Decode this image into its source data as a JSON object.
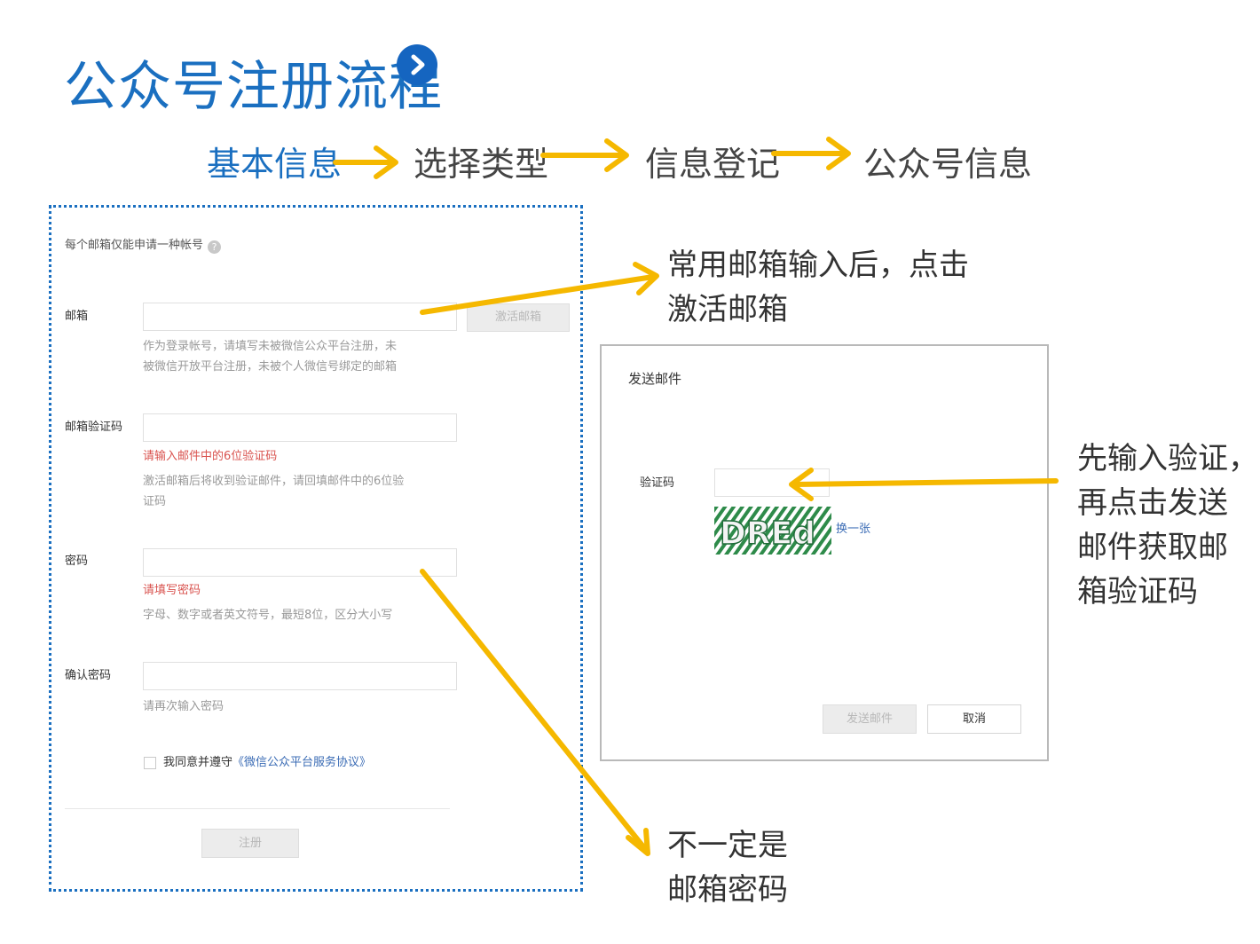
{
  "slide": {
    "title": "公众号注册流程",
    "next_icon": "chevron-right-icon"
  },
  "steps": [
    "基本信息",
    "选择类型",
    "信息登记",
    "公众号信息"
  ],
  "form": {
    "notice": "每个邮箱仅能申请一种帐号",
    "help_icon": "question-icon",
    "email": {
      "label": "邮箱",
      "value": "",
      "activate_button": "激活邮箱",
      "hint_line1": "作为登录帐号，请填写未被微信公众平台注册，未",
      "hint_line2": "被微信开放平台注册，未被个人微信号绑定的邮箱"
    },
    "verify": {
      "label": "邮箱验证码",
      "value": "",
      "error": "请输入邮件中的6位验证码",
      "hint_line1": "激活邮箱后将收到验证邮件，请回填邮件中的6位验",
      "hint_line2": "证码"
    },
    "password": {
      "label": "密码",
      "value": "",
      "error": "请填写密码",
      "hint": "字母、数字或者英文符号，最短8位，区分大小写"
    },
    "confirm": {
      "label": "确认密码",
      "value": "",
      "hint": "请再次输入密码"
    },
    "agree": {
      "prefix": "我同意并遵守",
      "link": "《微信公众平台服务协议》",
      "checked": false
    },
    "register_button": "注册"
  },
  "dialog": {
    "title": "发送邮件",
    "captcha_label": "验证码",
    "captcha_value": "",
    "captcha_text": "DREd",
    "refresh_link": "换一张",
    "send_button": "发送邮件",
    "cancel_button": "取消"
  },
  "callouts": {
    "email_line1": "常用邮箱输入后，点击",
    "email_line2": "激活邮箱",
    "captcha_line1": "先输入验证，",
    "captcha_line2": "再点击发送",
    "captcha_line3": "邮件获取邮",
    "captcha_line4": "箱验证码",
    "password_line1": "不一定是",
    "password_line2": "邮箱密码"
  },
  "colors": {
    "title_blue": "#1a6fc0",
    "arrow_yellow": "#f5b800",
    "error_red": "#d9534f",
    "captcha_green": "#2e8b4a"
  }
}
